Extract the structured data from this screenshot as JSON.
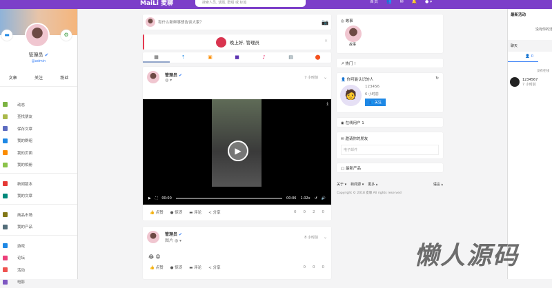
{
  "header": {
    "logo": "MaiLi 麦聊",
    "search_placeholder": "搜索人员, 话题, 群组 或 标签",
    "home": "首页"
  },
  "profile": {
    "name": "管理员",
    "handle": "@admin",
    "stats": [
      "文章",
      "关注",
      "粉丝"
    ]
  },
  "nav": [
    {
      "label": "动态",
      "color": "#7cb342"
    },
    {
      "label": "查找朋友",
      "color": "#aab94a"
    },
    {
      "label": "保存文章",
      "color": "#5c6bc0"
    },
    {
      "label": "我的群组",
      "color": "#1e88e5"
    },
    {
      "label": "我的页面",
      "color": "#fb8c00"
    },
    {
      "label": "我的相册",
      "color": "#8bc34a"
    },
    {
      "label": "新闻版本",
      "color": "#e53935"
    },
    {
      "label": "我的文章",
      "color": "#00897b"
    },
    {
      "label": "商品市场",
      "color": "#827717"
    },
    {
      "label": "我的产品",
      "color": "#546e7a"
    },
    {
      "label": "游戏",
      "color": "#1e88e5"
    },
    {
      "label": "论坛",
      "color": "#ec407a"
    },
    {
      "label": "活动",
      "color": "#ef5350"
    },
    {
      "label": "电影",
      "color": "#7e57c2"
    }
  ],
  "composer": {
    "placeholder": "有什么新鲜事想告诉大家？"
  },
  "greeting": "晚上好, 管理员",
  "post_tabs": [
    "▦",
    "⇡",
    "▣",
    "■",
    "♪",
    "▤",
    "⬤"
  ],
  "posts": [
    {
      "author": "管理员",
      "time": "7 小时前",
      "sub": "◍ ▾",
      "video": {
        "current": "00:00",
        "duration": "00:06",
        "speed": "1.02x"
      },
      "actions": [
        "点赞",
        "惊讶",
        "评论",
        "分享"
      ],
      "counts": [
        "0",
        "0",
        "2",
        "0"
      ]
    },
    {
      "author": "管理员",
      "time": "8 小时前",
      "sub": "图片 ◍ ▾",
      "body": "😂 😡",
      "actions": [
        "点赞",
        "惊讶",
        "评论",
        "分享"
      ],
      "counts": [
        "0",
        "0",
        "0"
      ]
    }
  ],
  "widgets": {
    "stories_title": "故事",
    "story_label": "故事",
    "trending": "热门 !",
    "suggest_title": "你可能认识的人",
    "suggest_name": "123456",
    "suggest_time": "6 小时前",
    "follow": "关注",
    "online": "在线用户 1",
    "invite_title": "邀请你的朋友",
    "invite_placeholder": "电子邮件",
    "products": "最新产品",
    "footer_links": [
      "关于 ▾",
      "新闻源 ▾",
      "更多 ▴"
    ],
    "lang": "语言 ▴",
    "copyright": "Copyright © 2018 麦聊 All rights reserved"
  },
  "right_panel": {
    "title": "最新活动",
    "empty": "没有你的活动",
    "chat": "聊天",
    "online_count": "0",
    "no_online": "没有在线",
    "user_name": "1234567",
    "user_time": "7 小时前"
  },
  "watermark": "懒人源码"
}
